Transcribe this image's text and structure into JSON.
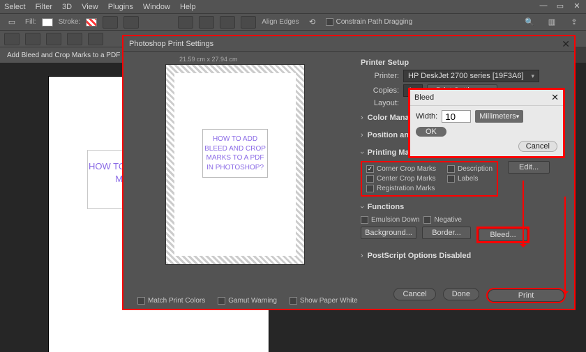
{
  "menu": {
    "items": [
      "Select",
      "Filter",
      "3D",
      "View",
      "Plugins",
      "Window",
      "Help"
    ]
  },
  "window_buttons": {
    "min": "—",
    "restore": "▭",
    "close": "✕"
  },
  "toolbar": {
    "fill_label": "Fill:",
    "stroke_label": "Stroke:",
    "align_edges": "Align Edges",
    "constrain": "Constrain Path Dragging"
  },
  "tab": {
    "title": "Add Bleed and Crop Marks to a PDF in Photos"
  },
  "document_text": "HOW TO ADD BLEED AND CROP MARKS TO A PDF IN PHOTOSHOP?",
  "document_text_clip": "HO\nAND\nPDF",
  "dialog": {
    "title": "Photoshop Print Settings",
    "paper_dim": "21.59 cm x 27.94 cm",
    "preview_opts": {
      "match": "Match Print Colors",
      "gamut": "Gamut Warning",
      "white": "Show Paper White"
    },
    "printer_setup": {
      "heading": "Printer Setup",
      "printer_label": "Printer:",
      "printer_value": "HP DeskJet 2700 series [19F3A6]",
      "copies_label": "Copies:",
      "copies_value": "1",
      "print_settings_btn": "Print Settings...",
      "layout_label": "Layout:"
    },
    "sections": {
      "color_mgmt": "Color Manag",
      "position": "Position and",
      "printing_marks": "Printing Marks",
      "functions": "Functions",
      "postscript": "PostScript Options Disabled"
    },
    "marks": {
      "corner": "Corner Crop Marks",
      "center": "Center Crop Marks",
      "registration": "Registration Marks",
      "description": "Description",
      "labels": "Labels",
      "edit_btn": "Edit..."
    },
    "functions_row": {
      "emulsion": "Emulsion Down",
      "negative": "Negative",
      "background_btn": "Background...",
      "border_btn": "Border...",
      "bleed_btn": "Bleed..."
    },
    "footer": {
      "cancel": "Cancel",
      "done": "Done",
      "print": "Print"
    }
  },
  "bleed_popup": {
    "title": "Bleed",
    "width_label": "Width:",
    "width_value": "10",
    "unit": "Millimeters",
    "ok": "OK",
    "cancel": "Cancel"
  }
}
